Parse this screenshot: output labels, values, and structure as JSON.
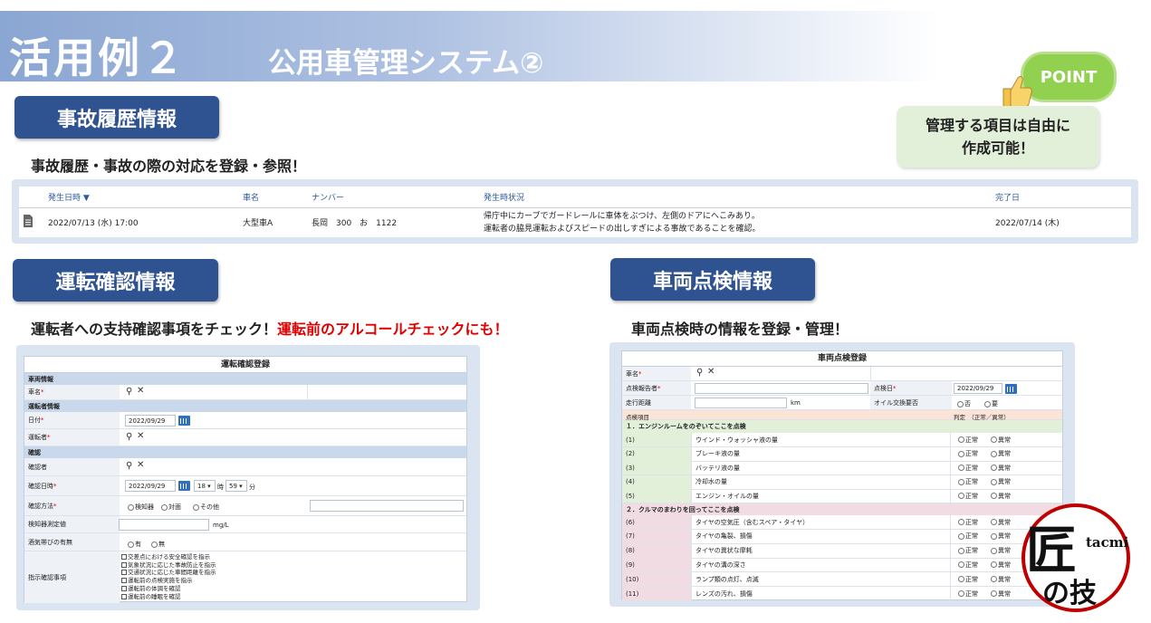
{
  "header": {
    "title_main": "活用例２",
    "title_sub": "公用車管理システム②"
  },
  "point": {
    "badge": "POINT",
    "note_line1": "管理する項目は自由に",
    "note_line2": "作成可能！"
  },
  "accident": {
    "heading": "事故履歴情報",
    "desc": "事故履歴・事故の際の対応を登録・参照！",
    "columns": [
      "発生日時 ▼",
      "車名",
      "ナンバー",
      "発生時状況",
      "完了日"
    ],
    "rows": [
      {
        "date": "2022/07/13 (水) 17:00",
        "car": "大型車A",
        "number": "長岡　300　お　1122",
        "situation_line1": "帰庁中にカーブでガードレールに車体をぶつけ、左側のドアにへこみあり。",
        "situation_line2": "運転者の脇見運転およびスピードの出しすぎによる事故であることを確認。",
        "completed": "2022/07/14 (木)"
      }
    ]
  },
  "driving": {
    "heading": "運転確認情報",
    "desc_black": "運転者への支持確認事項をチェック！",
    "desc_red": "運転前のアルコールチェックにも！",
    "form": {
      "title": "運転確認登録",
      "group_vehicle": "車両情報",
      "car_label": "車名",
      "group_driver": "運転者情報",
      "date_label": "日付",
      "date_value": "2022/09/29",
      "driver_label": "運転者",
      "group_confirm": "確認",
      "confirmer_label": "確認者",
      "confirm_dt_label": "確認日時",
      "confirm_date": "2022/09/29",
      "hour": "18",
      "hour_unit": "時",
      "minute": "59",
      "minute_unit": "分",
      "method_label": "確認方法",
      "method_options": [
        "検知器",
        "対面",
        "その他"
      ],
      "measure_label": "検知器測定値",
      "measure_unit": "mg/L",
      "alcohol_label": "酒気帯びの有無",
      "alcohol_options": [
        "有",
        "無"
      ],
      "instruct_label": "指示確認事項",
      "instruct_items": [
        "交差点における安全確認を指示",
        "気象状況に応じた事故防止を指示",
        "交通状況に応じた車間距離を指示",
        "運転前の点検実施を指示",
        "運転前の体調を確認",
        "運転前の睡眠を確認"
      ],
      "required_mark": "*"
    }
  },
  "inspection": {
    "heading": "車両点検情報",
    "desc": "車両点検時の情報を登録・管理！",
    "form": {
      "title": "車両点検登録",
      "car_label": "車名",
      "reporter_label": "点検報告者",
      "inspect_date_label": "点検日",
      "inspect_date": "2022/09/29",
      "mileage_label": "走行距離",
      "mileage_unit": "km",
      "oil_label": "オイル交換要否",
      "oil_options": [
        "否",
        "要"
      ],
      "item_header": "点検項目",
      "judge_header": "判定　（正常／異常）",
      "section1": "１．エンジンルームをのぞいてここを点検",
      "section2": "２．クルマのまわりを回ってここを点検",
      "judge_options": [
        "正常",
        "異常"
      ],
      "items": [
        {
          "no": "(1)",
          "name": "ウインド・ウォッシャ液の量"
        },
        {
          "no": "(2)",
          "name": "ブレーキ液の量"
        },
        {
          "no": "(3)",
          "name": "バッテリ液の量"
        },
        {
          "no": "(4)",
          "name": "冷却水の量"
        },
        {
          "no": "(5)",
          "name": "エンジン・オイルの量"
        },
        {
          "no": "(6)",
          "name": "タイヤの空気圧（含むスペア・タイヤ）"
        },
        {
          "no": "(7)",
          "name": "タイヤの亀裂、損傷"
        },
        {
          "no": "(8)",
          "name": "タイヤの異状な摩耗"
        },
        {
          "no": "(9)",
          "name": "タイヤの溝の深さ"
        },
        {
          "no": "(10)",
          "name": "ランプ類の点灯、点滅"
        },
        {
          "no": "(11)",
          "name": "レンズの汚れ、損傷"
        }
      ],
      "required_mark": "*"
    }
  },
  "logo": {
    "main": "匠",
    "sub": "の技",
    "latin": "tacmi"
  },
  "colors": {
    "heading_bg": "#2e5390",
    "accent_red": "#e00000",
    "point_green": "#92d050",
    "note_bg": "#e2efd9",
    "frame_bg": "#dbe5f1",
    "group_bg": "#c9d8ea",
    "engine_bg": "#e2efd9",
    "body_bg": "#f2dce4"
  }
}
